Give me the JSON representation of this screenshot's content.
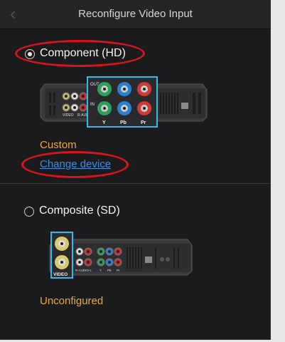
{
  "header": {
    "title": "Reconfigure Video Input",
    "back_icon": "chevron-left-icon"
  },
  "component": {
    "label": "Component (HD)",
    "selected": true,
    "status": "Custom",
    "change_link": "Change device",
    "port_labels": {
      "out": "OUT",
      "in": "IN",
      "y": "Y",
      "pb": "Pb",
      "pr": "Pr",
      "video": "VIDEO",
      "r_audio": "R-AUDIO"
    }
  },
  "composite": {
    "label": "Composite (SD)",
    "selected": false,
    "status": "Unconfigured",
    "port_labels": {
      "video": "VIDEO",
      "r_audio": "R-AUDIO-L",
      "y": "Y",
      "pb": "Pb",
      "pr": "Pr"
    }
  },
  "colors": {
    "accent_link": "#3b8fe0",
    "status": "#e8a93a",
    "annotation_ring": "#d81420",
    "highlight_box": "#35b7e8"
  }
}
